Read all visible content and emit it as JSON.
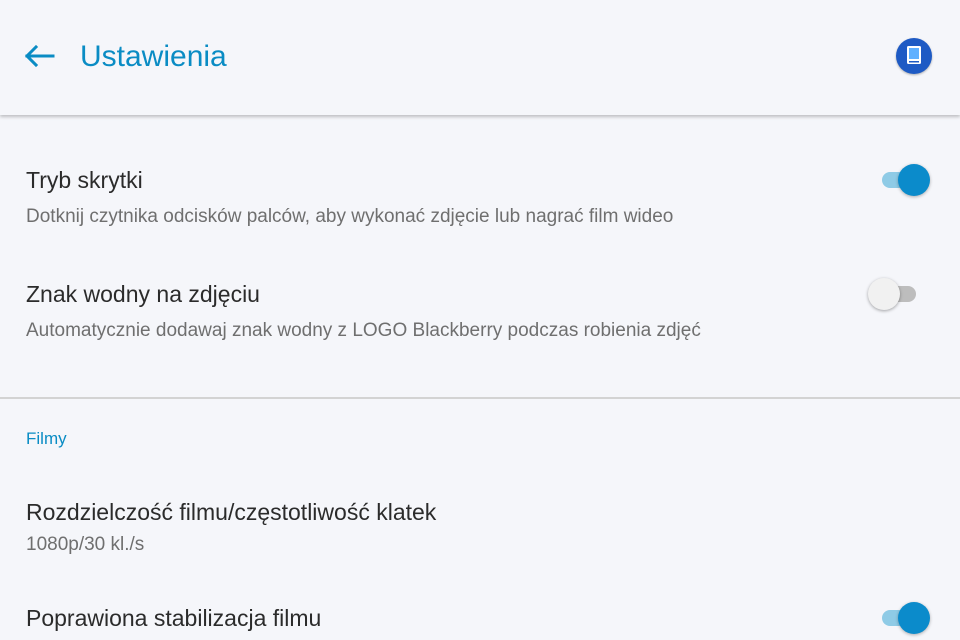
{
  "header": {
    "title": "Ustawienia",
    "back_icon": "arrow-left-icon",
    "app_icon": "blackberry-camera-app-icon"
  },
  "settings": [
    {
      "title": "Tryb skrytki",
      "subtitle": "Dotknij czytnika odcisków palców, aby wykonać zdjęcie lub nagrać film wideo",
      "toggle": "on"
    },
    {
      "title": "Znak wodny na zdjęciu",
      "subtitle": "Automatycznie dodawaj znak wodny z LOGO Blackberry podczas robienia zdjęć",
      "toggle": "off"
    }
  ],
  "section_films": {
    "header": "Filmy",
    "items": [
      {
        "title": "Rozdzielczość filmu/częstotliwość klatek",
        "subtitle": "1080p/30 kl./s"
      },
      {
        "title": "Poprawiona stabilizacja filmu",
        "toggle": "on"
      }
    ]
  },
  "colors": {
    "accent": "#0a8cc4",
    "switch_on_thumb": "#0b8bcb",
    "switch_on_track": "#8fcbe6",
    "background": "#f5f6fa"
  }
}
